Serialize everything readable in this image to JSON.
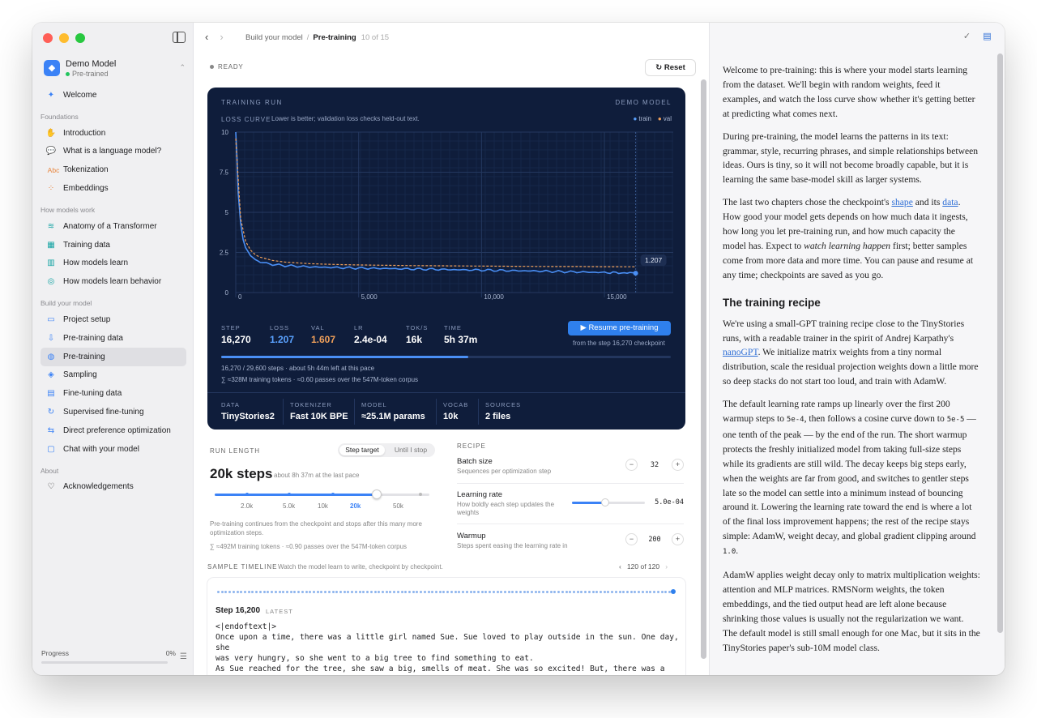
{
  "sidebar": {
    "model": {
      "name": "Demo Model",
      "status": "Pre-trained"
    },
    "welcome": "Welcome",
    "sections": [
      {
        "title": "Foundations",
        "items": [
          {
            "label": "Introduction",
            "icon": "hand-wave-icon"
          },
          {
            "label": "What is a language model?",
            "icon": "chat-bubble-icon"
          },
          {
            "label": "Tokenization",
            "icon": "abc-icon"
          },
          {
            "label": "Embeddings",
            "icon": "dots-grid-icon"
          }
        ]
      },
      {
        "title": "How models work",
        "items": [
          {
            "label": "Anatomy of a Transformer",
            "icon": "layers-icon"
          },
          {
            "label": "Training data",
            "icon": "table-icon"
          },
          {
            "label": "How models learn",
            "icon": "chart-icon"
          },
          {
            "label": "How models learn behavior",
            "icon": "chat-bubbles-icon"
          }
        ]
      },
      {
        "title": "Build your model",
        "items": [
          {
            "label": "Project setup",
            "icon": "folder-icon"
          },
          {
            "label": "Pre-training data",
            "icon": "download-icon"
          },
          {
            "label": "Pre-training",
            "icon": "brain-icon",
            "active": true
          },
          {
            "label": "Sampling",
            "icon": "dice-icon"
          },
          {
            "label": "Fine-tuning data",
            "icon": "document-icon"
          },
          {
            "label": "Supervised fine-tuning",
            "icon": "refresh-icon"
          },
          {
            "label": "Direct preference optimization",
            "icon": "preference-icon"
          },
          {
            "label": "Chat with your model",
            "icon": "chat-icon"
          }
        ]
      },
      {
        "title": "About",
        "items": [
          {
            "label": "Acknowledgements",
            "icon": "heart-icon"
          }
        ]
      }
    ],
    "progress": {
      "label": "Progress",
      "value_text": "0%",
      "value": 0
    }
  },
  "topbar": {
    "crumb_parent": "Build your model",
    "crumb_current": "Pre-training",
    "crumb_count": "10 of 15"
  },
  "status": "READY",
  "reset_label": "Reset",
  "panel": {
    "head_left": "TRAINING RUN",
    "head_right": "DEMO MODEL",
    "loss_title": "LOSS CURVE",
    "loss_desc": "Lower is better; validation loss checks held-out text.",
    "legend_train": "train",
    "legend_val": "val",
    "stats": [
      {
        "label": "STEP",
        "value": "16,270",
        "tone": ""
      },
      {
        "label": "LOSS",
        "value": "1.207",
        "tone": "blue"
      },
      {
        "label": "VAL",
        "value": "1.607",
        "tone": "orange"
      },
      {
        "label": "LR",
        "value": "2.4e-04",
        "tone": ""
      },
      {
        "label": "TOK/S",
        "value": "16k",
        "tone": ""
      },
      {
        "label": "TIME",
        "value": "5h 37m",
        "tone": ""
      }
    ],
    "resume_label": "Resume pre-training",
    "resume_sub": "from the step 16,270 checkpoint",
    "run_progress": 0.55,
    "run_note1": "16,270 / 29,600 steps · about 5h 44m left at this pace",
    "run_note2": "∑  ≈328M training tokens · ≈0.60 passes over the 547M-token corpus",
    "meta": [
      {
        "label": "DATA",
        "value": "TinyStories2"
      },
      {
        "label": "TOKENIZER",
        "value": "Fast 10K BPE"
      },
      {
        "label": "MODEL",
        "value": "≈25.1M params"
      },
      {
        "label": "VOCAB",
        "value": "10k"
      },
      {
        "label": "SOURCES",
        "value": "2 files"
      }
    ]
  },
  "chart_data": {
    "type": "line",
    "title": "LOSS CURVE",
    "x_ticks": [
      "0",
      "5,000",
      "10,000",
      "15,000"
    ],
    "y_ticks": [
      "0",
      "2.5",
      "5",
      "7.5",
      "10"
    ],
    "xlim": [
      0,
      17800
    ],
    "ylim": [
      0,
      10
    ],
    "annotation": "1.207",
    "series": [
      {
        "name": "train",
        "color": "#4a8ff5",
        "x": [
          0,
          50,
          100,
          200,
          300,
          400,
          600,
          800,
          1000,
          1500,
          2000,
          3000,
          4000,
          5000,
          6000,
          7000,
          8000,
          9000,
          10000,
          11000,
          12000,
          13000,
          14000,
          15000,
          16270
        ],
        "y": [
          10,
          8.4,
          6.2,
          4.3,
          3.3,
          2.8,
          2.3,
          2.05,
          1.9,
          1.75,
          1.68,
          1.6,
          1.56,
          1.52,
          1.5,
          1.47,
          1.45,
          1.42,
          1.4,
          1.37,
          1.35,
          1.31,
          1.28,
          1.25,
          1.207
        ]
      },
      {
        "name": "val",
        "color": "#f0a05a",
        "x": [
          0,
          200,
          400,
          600,
          800,
          1000,
          1500,
          2000,
          3000,
          4000,
          5000,
          6000,
          7000,
          8000,
          9000,
          10000,
          11000,
          12000,
          13000,
          14000,
          15000,
          16270
        ],
        "y": [
          9.6,
          4.6,
          3.2,
          2.65,
          2.35,
          2.2,
          2.0,
          1.9,
          1.8,
          1.75,
          1.72,
          1.7,
          1.68,
          1.67,
          1.66,
          1.65,
          1.64,
          1.63,
          1.62,
          1.62,
          1.61,
          1.607
        ]
      }
    ]
  },
  "run_length": {
    "title": "RUN LENGTH",
    "mode_on": "Step target",
    "mode_off": "Until I stop",
    "value": "20k steps",
    "sub": "about 8h 37m at the last pace",
    "ticks": [
      "2.0k",
      "5.0k",
      "10k",
      "20k",
      "50k"
    ],
    "selected_index": 3,
    "note": "Pre-training continues from the checkpoint and stops after this many more optimization steps.",
    "note2": "∑  ≈492M training tokens · ≈0.90 passes over the 547M-token corpus"
  },
  "recipe": {
    "title": "RECIPE",
    "batch": {
      "name": "Batch size",
      "desc": "Sequences per optimization step",
      "value": "32"
    },
    "lr": {
      "name": "Learning rate",
      "desc": "How boldly each step updates the weights",
      "value": "5.0e-04",
      "level": 0.45
    },
    "warmup": {
      "name": "Warmup",
      "desc": "Steps spent easing the learning rate in",
      "value": "200"
    }
  },
  "timeline": {
    "title": "SAMPLE TIMELINE",
    "desc": "Watch the model learn to write, checkpoint by checkpoint.",
    "count": "120 of 120",
    "step": "Step 16,200",
    "latest": "LATEST",
    "text": "<|endoftext|>\nOnce upon a time, there was a little girl named Sue. Sue loved to play outside in the sun. One day, she\nwas very hungry, so she went to a big tree to find something to eat.\nAs Sue reached for the tree, she saw a big, smells of meat. She was so excited! But, there was a\nproblem. The meat was on the tree, and it was too high for her to reach. Sue tried to jump, but she"
  },
  "reader": {
    "p1": "Welcome to pre-training: this is where your model starts learning from the dataset. We'll begin with random weights, feed it examples, and watch the loss curve show whether it's getting better at predicting what comes next.",
    "p2": "During pre-training, the model learns the patterns in its text: grammar, style, recurring phrases, and simple relationships between ideas. Ours is tiny, so it will not become broadly capable, but it is learning the same base-model skill as larger systems.",
    "p3a": "The last two chapters chose the checkpoint's ",
    "p3_link1": "shape",
    "p3b": " and its ",
    "p3_link2": "data",
    "p3c": ". How good your model gets depends on how much data it ingests, how long you let pre-training run, and how much capacity the model has. Expect to ",
    "p3_em": "watch learning happen",
    "p3d": " first; better samples come from more data and more time. You can pause and resume at any time; checkpoints are saved as you go.",
    "h_recipe": "The training recipe",
    "p4a": "We're using a small-GPT training recipe close to the TinyStories runs, with a readable trainer in the spirit of Andrej Karpathy's ",
    "p4_link": "nanoGPT",
    "p4b": ". We initialize matrix weights from a tiny normal distribution, scale the residual projection weights down a little more so deep stacks do not start too loud, and train with AdamW.",
    "p5a": "The default learning rate ramps up linearly over the first 200 warmup steps to ",
    "p5_code1": "5e-4",
    "p5b": ", then follows a cosine curve down to ",
    "p5_code2": "5e-5",
    "p5c": " — one tenth of the peak — by the end of the run. The short warmup protects the freshly initialized model from taking full-size steps while its gradients are still wild. The decay keeps big steps early, when the weights are far from good, and switches to gentler steps late so the model can settle into a minimum instead of bouncing around it. Lowering the learning rate toward the end is where a lot of the final loss improvement happens; the rest of the recipe stays simple: AdamW, weight decay, and global gradient clipping around ",
    "p5_code3": "1.0",
    "p5d": ".",
    "p6": "AdamW applies weight decay only to matrix multiplication weights: attention and MLP matrices. RMSNorm weights, the token embeddings, and the tied output head are left alone because shrinking those values is usually not the regularization we want. The default model is still small enough for one Mac, but it sits in the TinyStories paper's sub-10M model class."
  }
}
